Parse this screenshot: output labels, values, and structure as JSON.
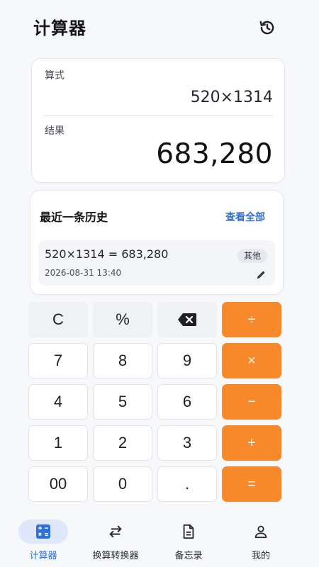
{
  "header": {
    "title": "计算器",
    "history_icon": "history-icon"
  },
  "display": {
    "expression_label": "算式",
    "expression": "520×1314",
    "result_label": "结果",
    "result": "683,280"
  },
  "recent": {
    "title": "最近一条历史",
    "view_all": "查看全部",
    "item": {
      "expression": "520×1314 = 683,280",
      "datetime": "2026-08-31  13:40",
      "tag": "其他",
      "edit_icon": "pencil-icon"
    }
  },
  "keypad": {
    "rows": [
      [
        {
          "label": "C",
          "name": "clear"
        },
        {
          "label": "%",
          "name": "percent"
        },
        {
          "label": "",
          "name": "backspace",
          "icon": "backspace-icon"
        },
        {
          "label": "÷",
          "name": "divide"
        }
      ],
      [
        {
          "label": "7",
          "name": "digit-7"
        },
        {
          "label": "8",
          "name": "digit-8"
        },
        {
          "label": "9",
          "name": "digit-9"
        },
        {
          "label": "×",
          "name": "multiply"
        }
      ],
      [
        {
          "label": "4",
          "name": "digit-4"
        },
        {
          "label": "5",
          "name": "digit-5"
        },
        {
          "label": "6",
          "name": "digit-6"
        },
        {
          "label": "−",
          "name": "subtract"
        }
      ],
      [
        {
          "label": "1",
          "name": "digit-1"
        },
        {
          "label": "2",
          "name": "digit-2"
        },
        {
          "label": "3",
          "name": "digit-3"
        },
        {
          "label": "+",
          "name": "add"
        }
      ],
      [
        {
          "label": "00",
          "name": "double-zero"
        },
        {
          "label": "0",
          "name": "digit-0"
        },
        {
          "label": ".",
          "name": "decimal"
        },
        {
          "label": "=",
          "name": "equals"
        }
      ]
    ]
  },
  "nav": {
    "items": [
      {
        "label": "计算器",
        "icon": "calculator-icon",
        "active": true
      },
      {
        "label": "换算转换器",
        "icon": "swap-icon",
        "active": false
      },
      {
        "label": "备忘录",
        "icon": "document-icon",
        "active": false
      },
      {
        "label": "我的",
        "icon": "user-icon",
        "active": false
      }
    ]
  },
  "colors": {
    "accent": "#2f6fd9",
    "operator": "#f7892b",
    "function_key": "#eff1f5",
    "nav_active_bg": "#dfe8fb"
  }
}
